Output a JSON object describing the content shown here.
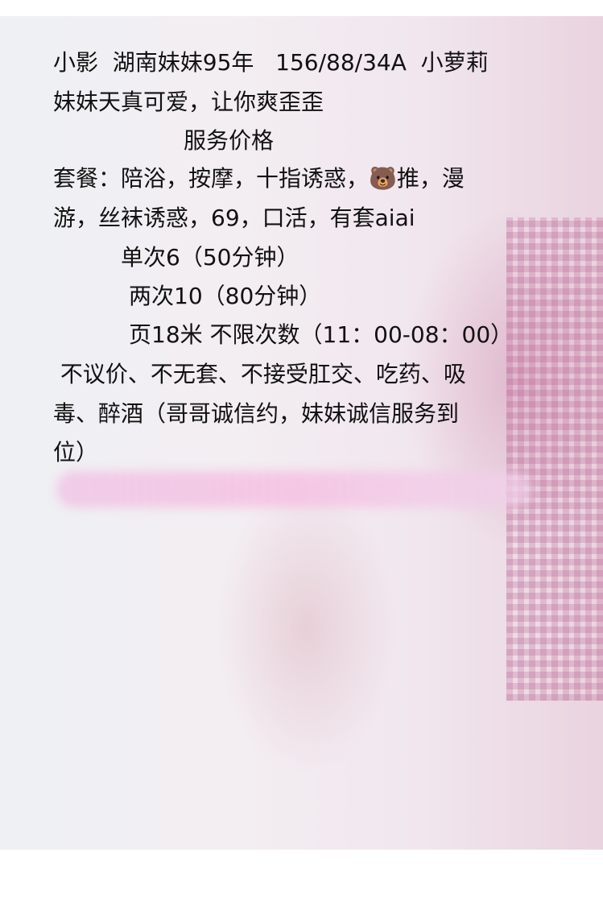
{
  "post": {
    "lines": [
      "小影  湖南妹妹95年   156/88/34A  小萝莉",
      "妹妹天真可爱，让你爽歪歪",
      "服务价格",
      "套餐：陪浴，按摩，十指诱惑，🐻推，漫",
      "游，丝袜诱惑，69，口活，有套aiai",
      "单次6（50分钟）",
      "两次10（80分钟）",
      "页18米 不限次数（11：00-08：00）",
      " 不议价、不无套、不接受肛交、吃药、吸",
      "毒、醉酒（哥哥诚信约，妹妹诚信服务到",
      "位）"
    ]
  }
}
